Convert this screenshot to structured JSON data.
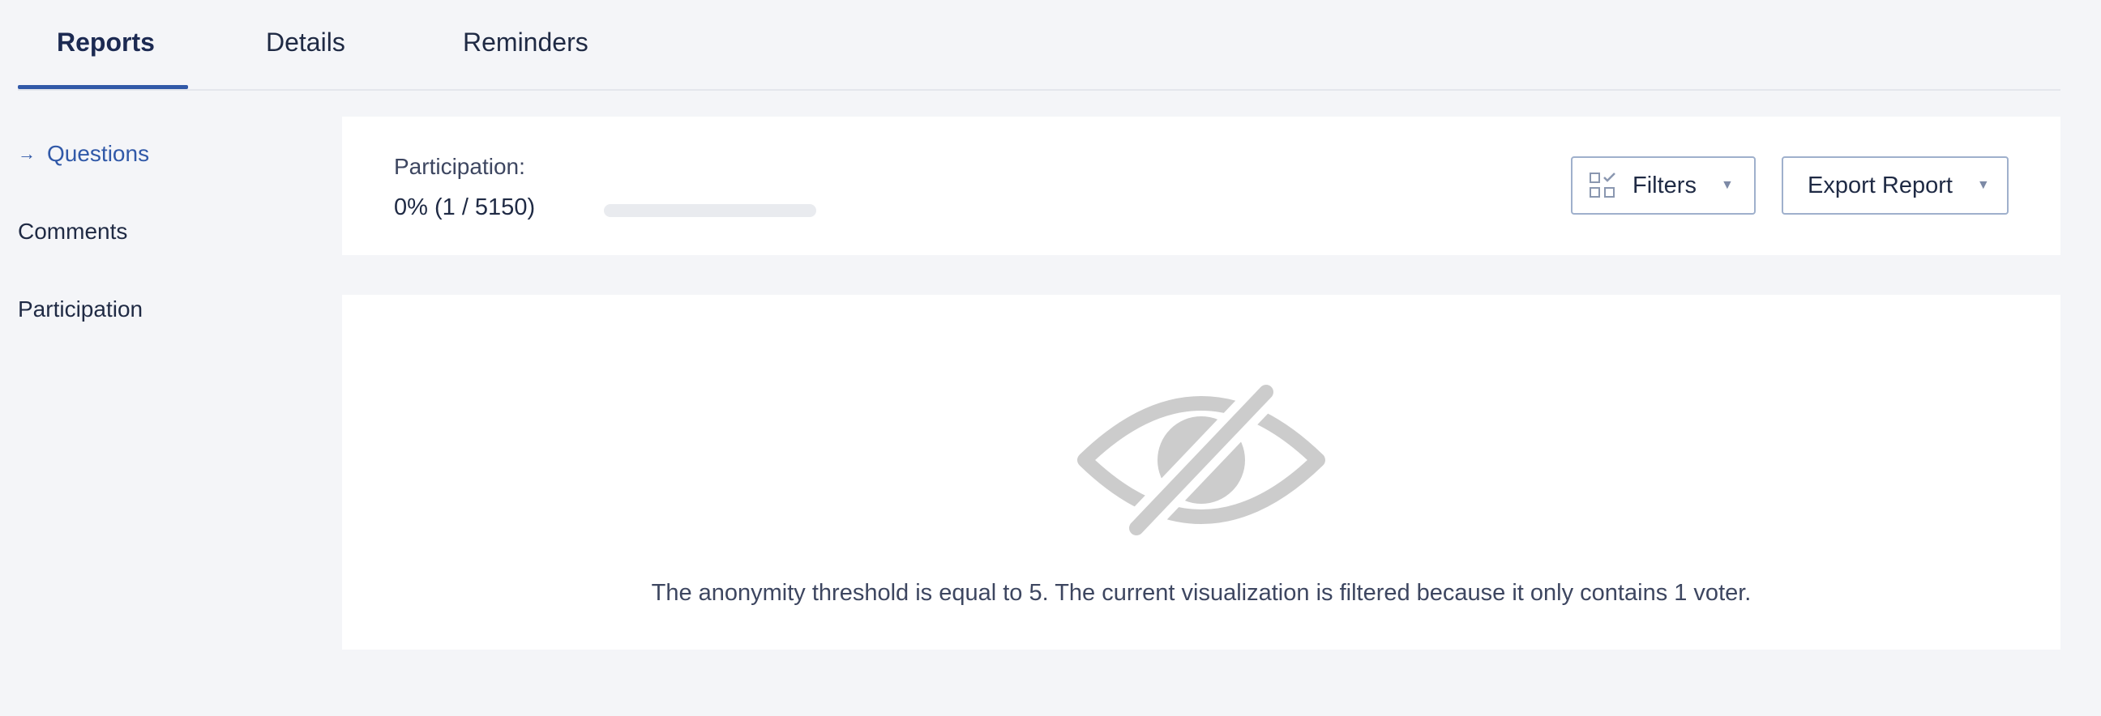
{
  "tabs": [
    {
      "label": "Reports",
      "active": true
    },
    {
      "label": "Details",
      "active": false
    },
    {
      "label": "Reminders",
      "active": false
    }
  ],
  "sidebar": {
    "items": [
      {
        "label": "Questions",
        "active": true,
        "icon": "arrow-right-icon"
      },
      {
        "label": "Comments",
        "active": false
      },
      {
        "label": "Participation",
        "active": false
      }
    ]
  },
  "participation": {
    "label": "Participation:",
    "value": "0% (1 / 5150)",
    "progress_fraction": 0.0002
  },
  "toolbar": {
    "filters_label": "Filters",
    "filters_icon": "filter-grid-icon",
    "export_label": "Export Report",
    "chevron_icon": "chevron-down-icon"
  },
  "notice": {
    "icon": "eye-off-icon",
    "text": "The anonymity threshold is equal to 5. The current visualization is filtered because it only contains 1 voter."
  },
  "colors": {
    "accent": "#3159a8",
    "background": "#f4f5f8",
    "panel": "#ffffff",
    "icon_muted": "#cccccc"
  }
}
